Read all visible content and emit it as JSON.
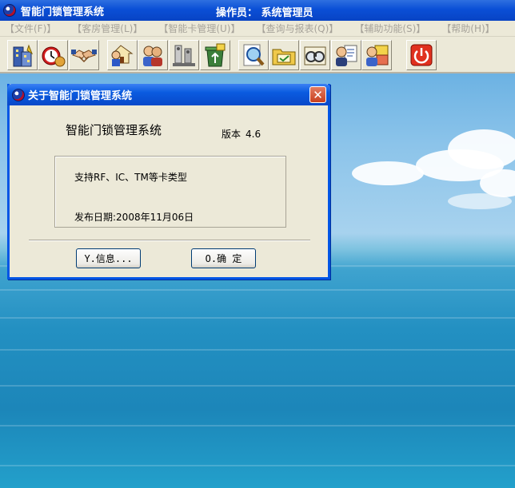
{
  "main_window": {
    "title": "智能门锁管理系统",
    "operator": "操作员： 系统管理员"
  },
  "menu": {
    "items": [
      {
        "label": "【文件(F)】"
      },
      {
        "label": "【客房管理(L)】"
      },
      {
        "label": "【智能卡管理(U)】"
      },
      {
        "label": "【查询与报表(Q)】"
      },
      {
        "label": "【辅助功能(S)】"
      },
      {
        "label": "【帮助(H)】"
      }
    ]
  },
  "toolbar": {
    "buttons": [
      {
        "icon": "building-icon"
      },
      {
        "icon": "alarm-clock-icon"
      },
      {
        "icon": "handshake-icon"
      },
      {
        "icon": "guest-house-icon"
      },
      {
        "icon": "two-users-icon"
      },
      {
        "icon": "keys-icon"
      },
      {
        "icon": "recycle-icon"
      },
      {
        "icon": "search-magnifier-icon"
      },
      {
        "icon": "card-folder-icon"
      },
      {
        "icon": "binoculars-icon"
      },
      {
        "icon": "user-report-icon"
      },
      {
        "icon": "user-card-icon"
      },
      {
        "icon": "power-exit-icon"
      }
    ]
  },
  "about_dialog": {
    "title": "关于智能门锁管理系统",
    "close_label": "✕",
    "app_name": "智能门锁管理系统",
    "version_label": "版本",
    "version_value": "4.6",
    "support_text": "支持RF、IC、TM等卡类型",
    "release_date": "发布日期:2008年11月06日",
    "info_button": "Y.信息...",
    "ok_button": "O.确  定"
  },
  "colors": {
    "title_blue": "#0a4fd6",
    "dialog_border": "#0055e5",
    "menu_disabled_text": "#a7a39a",
    "dialog_face": "#ece9d8"
  }
}
